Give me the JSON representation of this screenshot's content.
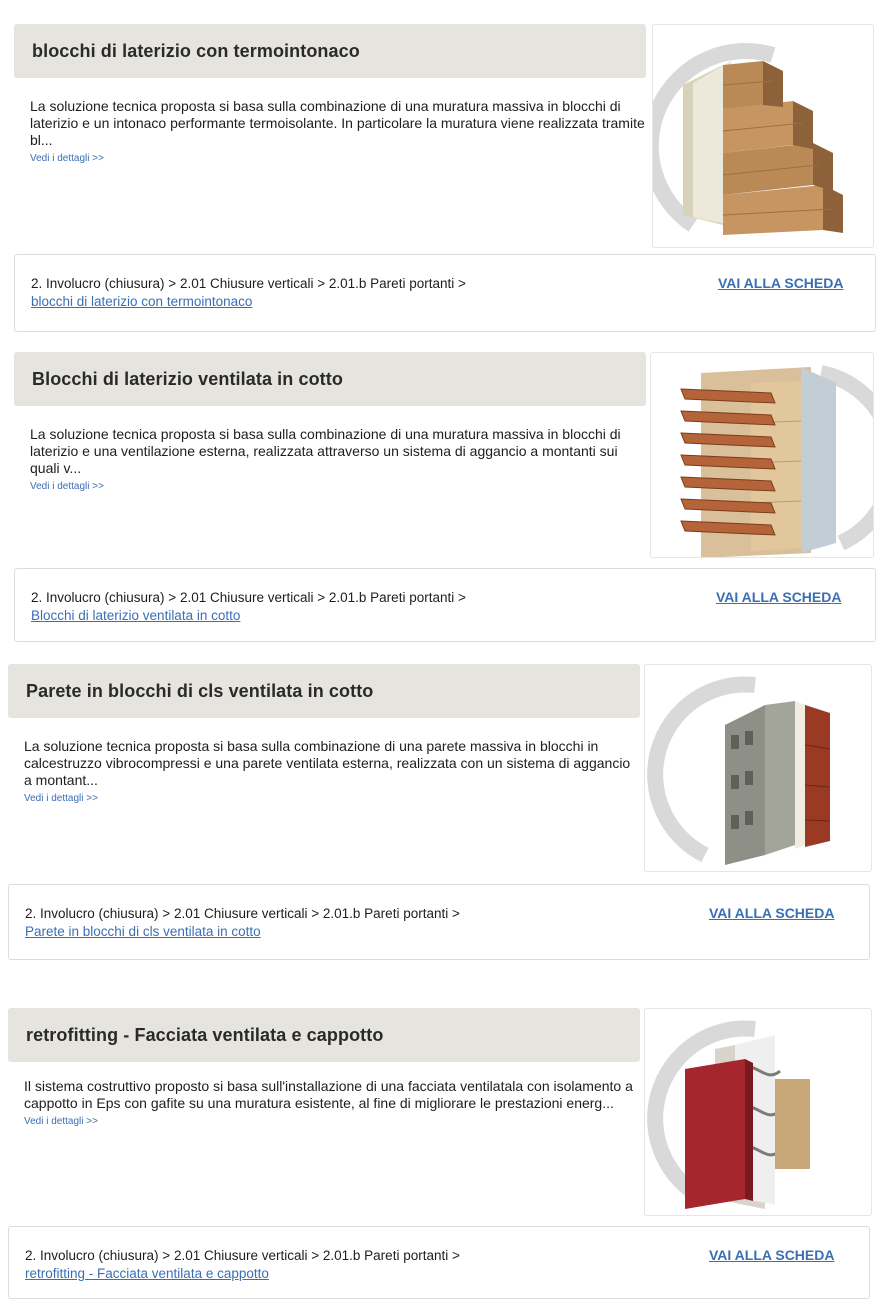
{
  "items": [
    {
      "title": "blocchi di laterizio con termointonaco",
      "description": "La soluzione tecnica proposta si basa sulla combinazione di una muratura massiva in blocchi di laterizio e un intonaco performante termoisolante. In particolare la muratura viene realizzata tramite bl...",
      "more_label": "Vedi i dettagli >>",
      "breadcrumb": "2. Involucro (chiusura) > 2.01 Chiusure verticali > 2.01.b Pareti portanti >",
      "breadcrumb_link": "blocchi di laterizio con termointonaco",
      "cta_label": "VAI ALLA SCHEDA",
      "image_icon": "brick-wall-plaster-icon"
    },
    {
      "title": "Blocchi di laterizio ventilata in cotto",
      "description": "La soluzione tecnica proposta si basa sulla combinazione di una muratura massiva in blocchi di laterizio e una ventilazione esterna, realizzata attraverso un sistema di aggancio a montanti sui quali v...",
      "more_label": "Vedi i dettagli >>",
      "breadcrumb": "2. Involucro (chiusura) > 2.01 Chiusure verticali > 2.01.b Pareti portanti >",
      "breadcrumb_link": "Blocchi di laterizio ventilata in cotto",
      "cta_label": "VAI ALLA SCHEDA",
      "image_icon": "ventilated-terracotta-wall-icon"
    },
    {
      "title": "Parete in blocchi di cls ventilata in cotto",
      "description": "La soluzione tecnica proposta si basa sulla combinazione di una parete massiva in blocchi in calcestruzzo vibrocompressi e una parete ventilata esterna, realizzata con un sistema di aggancio a montant...",
      "more_label": "Vedi i dettagli >>",
      "breadcrumb": "2. Involucro (chiusura) > 2.01 Chiusure verticali > 2.01.b Pareti portanti >",
      "breadcrumb_link": "Parete in blocchi di cls ventilata in cotto",
      "cta_label": "VAI ALLA SCHEDA",
      "image_icon": "concrete-block-wall-icon"
    },
    {
      "title": "retrofitting - Facciata ventilata e cappotto",
      "description": "Il sistema costruttivo proposto si basa sull'installazione di una facciata ventilatala con isolamento a cappotto in Eps con gafite su una muratura esistente, al fine di migliorare le prestazioni energ...",
      "more_label": "Vedi i dettagli >>",
      "breadcrumb": "2. Involucro (chiusura) > 2.01 Chiusure verticali > 2.01.b Pareti portanti >",
      "breadcrumb_link": "retrofitting - Facciata ventilata e cappotto",
      "cta_label": "VAI ALLA SCHEDA",
      "image_icon": "retrofit-facade-icon"
    }
  ],
  "colors": {
    "title_bar": "#e6e4df",
    "link": "#3a6fb5",
    "text": "#1e1e1e"
  }
}
